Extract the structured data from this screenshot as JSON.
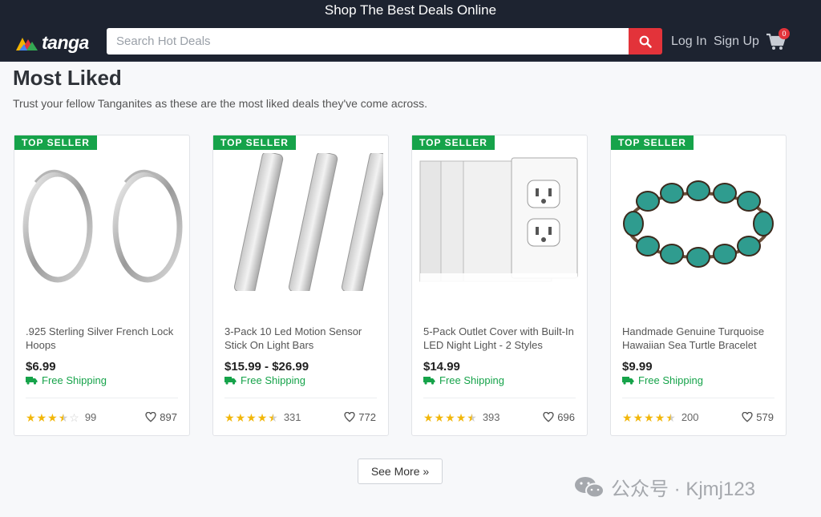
{
  "promo": {
    "text": "Shop The Best Deals Online"
  },
  "header": {
    "logo_text": "tanga",
    "search_placeholder": "Search Hot Deals",
    "login_label": "Log In",
    "signup_label": "Sign Up",
    "cart_count": "0",
    "colors": {
      "accent": "#e3333a",
      "nav_bg": "#1d2330",
      "green": "#16a34a"
    }
  },
  "section": {
    "title": "Most Liked",
    "subtitle": "Trust your fellow Tanganites as these are the most liked deals they've come across."
  },
  "products": [
    {
      "badge": "TOP SELLER",
      "name": ".925 Sterling Silver French Lock Hoops",
      "price": "$6.99",
      "shipping": "Free Shipping",
      "rating": 3.5,
      "reviews": "99",
      "likes": "897",
      "image_icon": "silver-hoop-earrings-image"
    },
    {
      "badge": "TOP SELLER",
      "name": "3-Pack 10 Led Motion Sensor Stick On Light Bars",
      "price": "$15.99 - $26.99",
      "shipping": "Free Shipping",
      "rating": 4.5,
      "reviews": "331",
      "likes": "772",
      "image_icon": "led-light-bars-image"
    },
    {
      "badge": "TOP SELLER",
      "name": "5-Pack Outlet Cover with Built-In LED Night Light - 2 Styles",
      "price": "$14.99",
      "shipping": "Free Shipping",
      "rating": 4.5,
      "reviews": "393",
      "likes": "696",
      "image_icon": "outlet-covers-image"
    },
    {
      "badge": "TOP SELLER",
      "name": "Handmade Genuine Turquoise Hawaiian Sea Turtle Bracelet",
      "price": "$9.99",
      "shipping": "Free Shipping",
      "rating": 4.5,
      "reviews": "200",
      "likes": "579",
      "image_icon": "turquoise-turtle-bracelet-image"
    }
  ],
  "see_more": {
    "label": "See More »"
  },
  "watermark": {
    "text": "公众号 · Kjmj123"
  }
}
